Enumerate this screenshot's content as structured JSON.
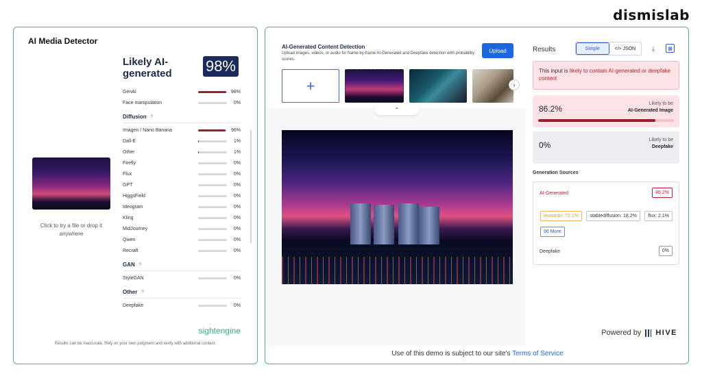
{
  "brand": "dismislab",
  "left": {
    "title": "AI Media Detector",
    "drop_text": "Click to try a file or drop it anywhere",
    "verdict": "Likely AI-generated",
    "score": "98%",
    "top_rows": [
      {
        "label": "GenAI",
        "pct": "98%",
        "value": 98
      },
      {
        "label": "Face manipulation",
        "pct": "0%",
        "value": 0
      }
    ],
    "sections": [
      {
        "name": "Diffusion",
        "help": "?",
        "rows": [
          {
            "label": "Imagen / Nano Banana",
            "pct": "96%",
            "value": 96
          },
          {
            "label": "Dall-E",
            "pct": "1%",
            "value": 1
          },
          {
            "label": "Other",
            "pct": "1%",
            "value": 1
          },
          {
            "label": "Firefly",
            "pct": "0%",
            "value": 0
          },
          {
            "label": "Flux",
            "pct": "0%",
            "value": 0
          },
          {
            "label": "GPT",
            "pct": "0%",
            "value": 0
          },
          {
            "label": "HiggsField",
            "pct": "0%",
            "value": 0
          },
          {
            "label": "Ideogram",
            "pct": "0%",
            "value": 0
          },
          {
            "label": "Kling",
            "pct": "0%",
            "value": 0
          },
          {
            "label": "MidJourney",
            "pct": "0%",
            "value": 0
          },
          {
            "label": "Qwen",
            "pct": "0%",
            "value": 0
          },
          {
            "label": "Recraft",
            "pct": "0%",
            "value": 0
          }
        ]
      },
      {
        "name": "GAN",
        "help": "?",
        "rows": [
          {
            "label": "StyleGAN",
            "pct": "0%",
            "value": 0
          }
        ]
      },
      {
        "name": "Other",
        "help": "?",
        "rows": [
          {
            "label": "Deepfake",
            "pct": "0%",
            "value": 0
          }
        ]
      }
    ],
    "provider": "sightengine",
    "disclaimer": "Results can be inaccurate. Rely on your own judgment and verify with additional context."
  },
  "mid": {
    "title": "AI-Generated Content Detection",
    "subtitle": "Upload images, videos, or audio for frame-by-frame AI-Generated and Deepfake detection with probability scores.",
    "upload_label": "Upload",
    "add_glyph": "+",
    "next_glyph": "›",
    "collapse_glyph": "⌃",
    "tos_prefix": "Use of this demo is subject to our site's ",
    "tos_link": "Terms of Service"
  },
  "right": {
    "title": "Results",
    "tab_simple": "Simple",
    "tab_json": "</> JSON",
    "alert_prefix": "This input is ",
    "alert_emph": "likely to contain AI-generated or deepfake content",
    "ai_pct": "86.2%",
    "ai_value": 86.2,
    "ai_meta_1": "Likely to be",
    "ai_meta_2": "AI-Generated Image",
    "df_pct": "0%",
    "df_meta_1": "Likely to be",
    "df_meta_2": "Deepfake",
    "gen_sources_title": "Generation Sources",
    "ai_generated_label": "AI-Generated",
    "ai_generated_pct": "86.2%",
    "chips": [
      "leonardo: 72.1%",
      "stablediffusion: 18.2%",
      "flux: 2.1%",
      "96 More"
    ],
    "deepfake_label": "Deepfake",
    "deepfake_pct": "0%",
    "powered_by": "Powered by",
    "powered_brand": "HIVE"
  }
}
